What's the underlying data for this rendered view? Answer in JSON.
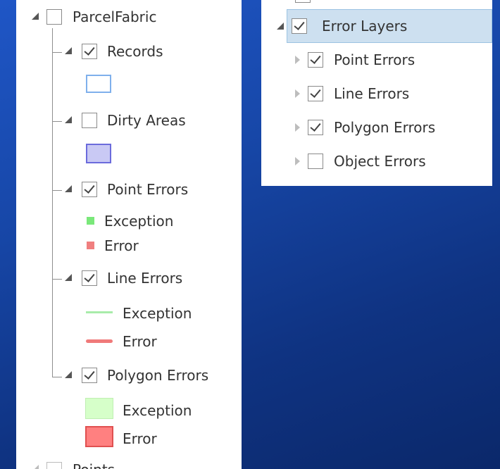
{
  "left_panel": {
    "root": {
      "label": "ParcelFabric",
      "checked": false,
      "expanded": true
    },
    "children": [
      {
        "label": "Records",
        "checked": true,
        "expanded": true,
        "symbol": {
          "type": "outline-box",
          "stroke": "#7fb0ec",
          "fill": "#ffffff"
        }
      },
      {
        "label": "Dirty Areas",
        "checked": false,
        "expanded": true,
        "symbol": {
          "type": "fill-box",
          "stroke": "#6b6bdc",
          "fill": "#c9c9f4"
        }
      },
      {
        "label": "Point Errors",
        "checked": true,
        "expanded": true,
        "legend": [
          {
            "label": "Exception",
            "color": "#7ae87a",
            "icon": "point-square"
          },
          {
            "label": "Error",
            "color": "#f07f7f",
            "icon": "point-square"
          }
        ]
      },
      {
        "label": "Line Errors",
        "checked": true,
        "expanded": true,
        "legend": [
          {
            "label": "Exception",
            "color": "#a8ecaa",
            "icon": "line-stroke"
          },
          {
            "label": "Error",
            "color": "#f07a7a",
            "icon": "line-stroke"
          }
        ]
      },
      {
        "label": "Polygon Errors",
        "checked": true,
        "expanded": true,
        "legend": [
          {
            "label": "Exception",
            "fill": "#d6ffc9",
            "stroke": "#bfeeb2",
            "icon": "polygon-box"
          },
          {
            "label": "Error",
            "fill": "#ff8080",
            "stroke": "#e05050",
            "icon": "polygon-box"
          }
        ]
      }
    ],
    "next_root_partial": {
      "label": "Points"
    }
  },
  "right_panel": {
    "root": {
      "label": "Error Layers",
      "checked": true,
      "expanded": true,
      "selected": true
    },
    "children": [
      {
        "label": "Point Errors",
        "checked": true,
        "expanded": false
      },
      {
        "label": "Line Errors",
        "checked": true,
        "expanded": false
      },
      {
        "label": "Polygon Errors",
        "checked": true,
        "expanded": false
      },
      {
        "label": "Object Errors",
        "checked": false,
        "expanded": false
      }
    ]
  }
}
